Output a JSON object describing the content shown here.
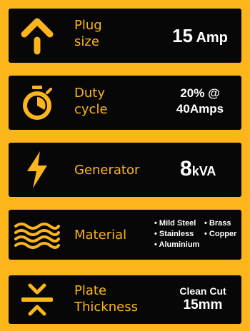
{
  "colors": {
    "accent": "#fcb61c",
    "card": "#070707",
    "text": "#ffffff"
  },
  "cards": [
    {
      "icon": "arrow-up-plug-icon",
      "label_lines": [
        "Plug",
        "size"
      ],
      "value_main": "15",
      "value_unit": "Amp"
    },
    {
      "icon": "stopwatch-icon",
      "label_lines": [
        "Duty",
        "cycle"
      ],
      "value_lines": [
        "20% @",
        "40Amps"
      ]
    },
    {
      "icon": "lightning-bolt-icon",
      "label_lines": [
        "Generator"
      ],
      "value_main": "8",
      "value_unit": "kVA"
    },
    {
      "icon": "wavy-layers-icon",
      "label_lines": [
        "Material"
      ],
      "bullets": [
        "• Mild Steel",
        "• Brass",
        "• Stainless",
        "• Copper",
        "• Aluminium"
      ]
    },
    {
      "icon": "plate-thickness-icon",
      "label_lines": [
        "Plate",
        "Thickness"
      ],
      "value_lines": [
        "Clean Cut",
        "15mm"
      ]
    }
  ]
}
